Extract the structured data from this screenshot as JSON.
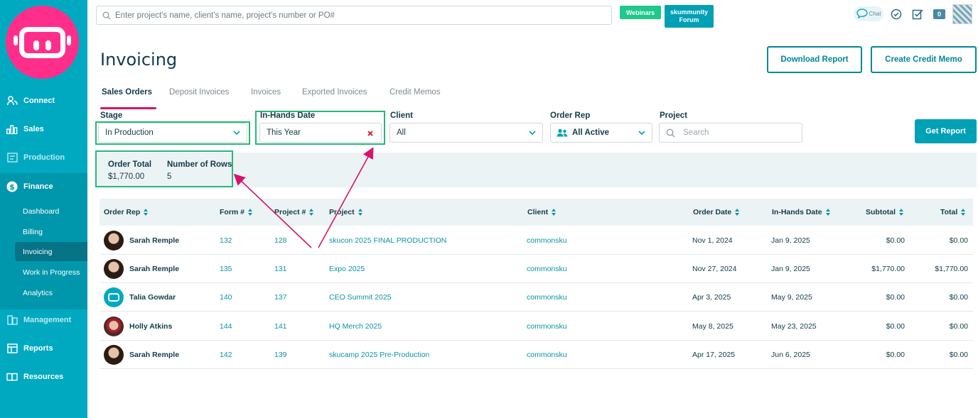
{
  "sidebar": {
    "items": [
      {
        "label": "Connect",
        "icon": "people-icon"
      },
      {
        "label": "Sales",
        "icon": "bar-chart-icon"
      },
      {
        "label": "Production",
        "icon": "production-icon"
      },
      {
        "label": "Finance",
        "icon": "dollar-icon"
      },
      {
        "label": "Management",
        "icon": "management-icon"
      },
      {
        "label": "Reports",
        "icon": "reports-icon"
      },
      {
        "label": "Resources",
        "icon": "book-icon"
      }
    ],
    "finance_sub": [
      "Dashboard",
      "Billing",
      "Invoicing",
      "Work in Progress",
      "Analytics"
    ],
    "active_sub": "Invoicing"
  },
  "topbar": {
    "search_placeholder": "Enter project's name, client's name, project's number or PO#",
    "webinars": "Webinars",
    "forum_line1": "skummunity",
    "forum_line2": "Forum",
    "chat": "Chat",
    "notification_count": "0"
  },
  "header": {
    "title": "Invoicing",
    "download_report": "Download Report",
    "create_credit_memo": "Create Credit Memo"
  },
  "tabs": [
    "Sales Orders",
    "Deposit Invoices",
    "Invoices",
    "Exported Invoices",
    "Credit Memos"
  ],
  "filters": {
    "stage_label": "Stage",
    "stage_value": "In Production",
    "in_hands_label": "In-Hands Date",
    "in_hands_value": "This Year",
    "client_label": "Client",
    "client_value": "All",
    "order_rep_label": "Order Rep",
    "order_rep_value": "All Active",
    "project_label": "Project",
    "project_placeholder": "Search",
    "get_report": "Get Report"
  },
  "summary": {
    "order_total_label": "Order Total",
    "order_total_value": "$1,770.00",
    "rows_label": "Number of Rows",
    "rows_value": "5"
  },
  "table": {
    "columns": [
      "Order Rep",
      "Form #",
      "Project #",
      "Project",
      "Client",
      "Order Date",
      "In-Hands Date",
      "Subtotal",
      "Total"
    ],
    "rows": [
      {
        "rep": "Sarah Remple",
        "avatar": "sarah",
        "form": "132",
        "project_no": "128",
        "project": "skucon 2025 FINAL PRODUCTION",
        "client": "commonsku",
        "order_date": "Nov 1, 2024",
        "in_hands": "Jan 9, 2025",
        "subtotal": "$0.00",
        "total": "$0.00"
      },
      {
        "rep": "Sarah Remple",
        "avatar": "sarah",
        "form": "135",
        "project_no": "131",
        "project": "Expo 2025",
        "client": "commonsku",
        "order_date": "Nov 27, 2024",
        "in_hands": "Jan 9, 2025",
        "subtotal": "$1,770.00",
        "total": "$1,770.00"
      },
      {
        "rep": "Talia Gowdar",
        "avatar": "talia",
        "form": "140",
        "project_no": "137",
        "project": "CEO Summit 2025",
        "client": "commonsku",
        "order_date": "Apr 3, 2025",
        "in_hands": "May 9, 2025",
        "subtotal": "$0.00",
        "total": "$0.00"
      },
      {
        "rep": "Holly Atkins",
        "avatar": "holly",
        "form": "144",
        "project_no": "141",
        "project": "HQ Merch 2025",
        "client": "commonsku",
        "order_date": "May 8, 2025",
        "in_hands": "May 23, 2025",
        "subtotal": "$0.00",
        "total": "$0.00"
      },
      {
        "rep": "Sarah Remple",
        "avatar": "sarah",
        "form": "142",
        "project_no": "139",
        "project": "skucamp 2025 Pre-Production",
        "client": "commonsku",
        "order_date": "Apr 17, 2025",
        "in_hands": "Jun 6, 2025",
        "subtotal": "$0.00",
        "total": "$0.00"
      }
    ]
  },
  "colors": {
    "sidebar": "#00a9c0",
    "brand_pink": "#ff2e8b",
    "highlight_green": "#26b877",
    "arrow": "#d6146e",
    "link": "#0b93a8"
  }
}
